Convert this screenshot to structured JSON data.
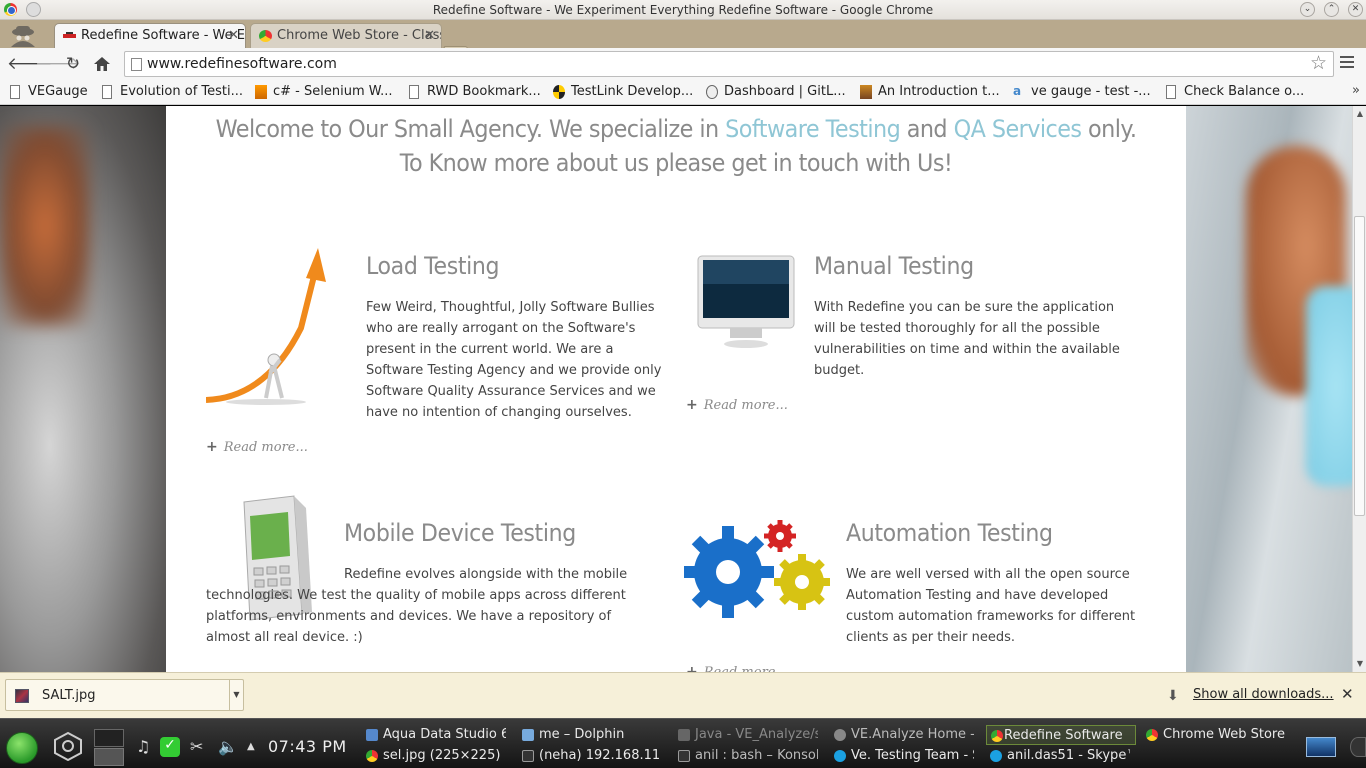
{
  "window": {
    "title": "Redefine Software - We Experiment Everything Redefine Software - Google Chrome"
  },
  "tabs": [
    {
      "label": "Redefine Software - We Experiment Everything"
    },
    {
      "label": "Chrome Web Store - Classic"
    }
  ],
  "toolbar": {
    "url": "www.redefinesoftware.com"
  },
  "bookmarks": [
    {
      "label": "VEGauge"
    },
    {
      "label": "Evolution of Testi..."
    },
    {
      "label": "c# - Selenium W..."
    },
    {
      "label": "RWD Bookmark..."
    },
    {
      "label": "TestLink Develop..."
    },
    {
      "label": "Dashboard | GitL..."
    },
    {
      "label": "An Introduction t..."
    },
    {
      "label": "ve gauge - test -..."
    },
    {
      "label": "Check Balance o..."
    }
  ],
  "page": {
    "welcome_1": "Welcome to Our Small Agency. We specialize in ",
    "welcome_hl1": "Software Testing",
    "welcome_and": " and ",
    "welcome_hl2": "QA Services",
    "welcome_2": " only. To Know more about us please get in touch with Us!",
    "read_more": "Read more...",
    "services": [
      {
        "title": "Load Testing",
        "text": "Few Weird, Thoughtful, Jolly Software Bullies who are really arrogant on the Software's present in the current world. We are a Software Testing Agency and we provide only Software Quality Assurance Services and we have no intention of changing ourselves."
      },
      {
        "title": "Manual Testing",
        "text": "With Redefine you can be sure the application will be tested thoroughly for all the possible vulnerabilities on time and within the available budget."
      },
      {
        "title": "Mobile Device Testing",
        "text": "Redefine evolves alongside with the mobile technologies. We test the quality of mobile apps across different platforms, environments and devices. We have a repository of almost all real device. :)"
      },
      {
        "title": "Automation Testing",
        "text": "We are well versed with all the open source Automation Testing and have developed custom automation frameworks for different clients as per their needs."
      }
    ]
  },
  "downloads": {
    "file": "SALT.jpg",
    "show_all": "Show all downloads..."
  },
  "taskbar": {
    "clock": "07:43 PM",
    "tasks": [
      {
        "label": "Aqua Data Studio 6"
      },
      {
        "label": "me – Dolphin"
      },
      {
        "label": "Java - VE_Analyze/s"
      },
      {
        "label": "VE.Analyze Home -"
      },
      {
        "label": "Redefine Software"
      },
      {
        "label": "Chrome Web Store"
      },
      {
        "label": "sel.jpg (225×225)"
      },
      {
        "label": "(neha) 192.168.11"
      },
      {
        "label": "anil : bash – Konsol"
      },
      {
        "label": "Ve. Testing Team - S"
      },
      {
        "label": "anil.das51 - Skype™"
      }
    ]
  },
  "colors": {
    "accent_link": "#8fc6d5",
    "heading_gray": "#8a8a8a",
    "tab_strip": "#b8a98d",
    "download_bar": "#f6f0d9"
  },
  "icons": [
    "back-icon",
    "forward-icon",
    "reload-icon",
    "home-icon",
    "star-icon",
    "menu-icon",
    "download-icon",
    "close-icon"
  ]
}
